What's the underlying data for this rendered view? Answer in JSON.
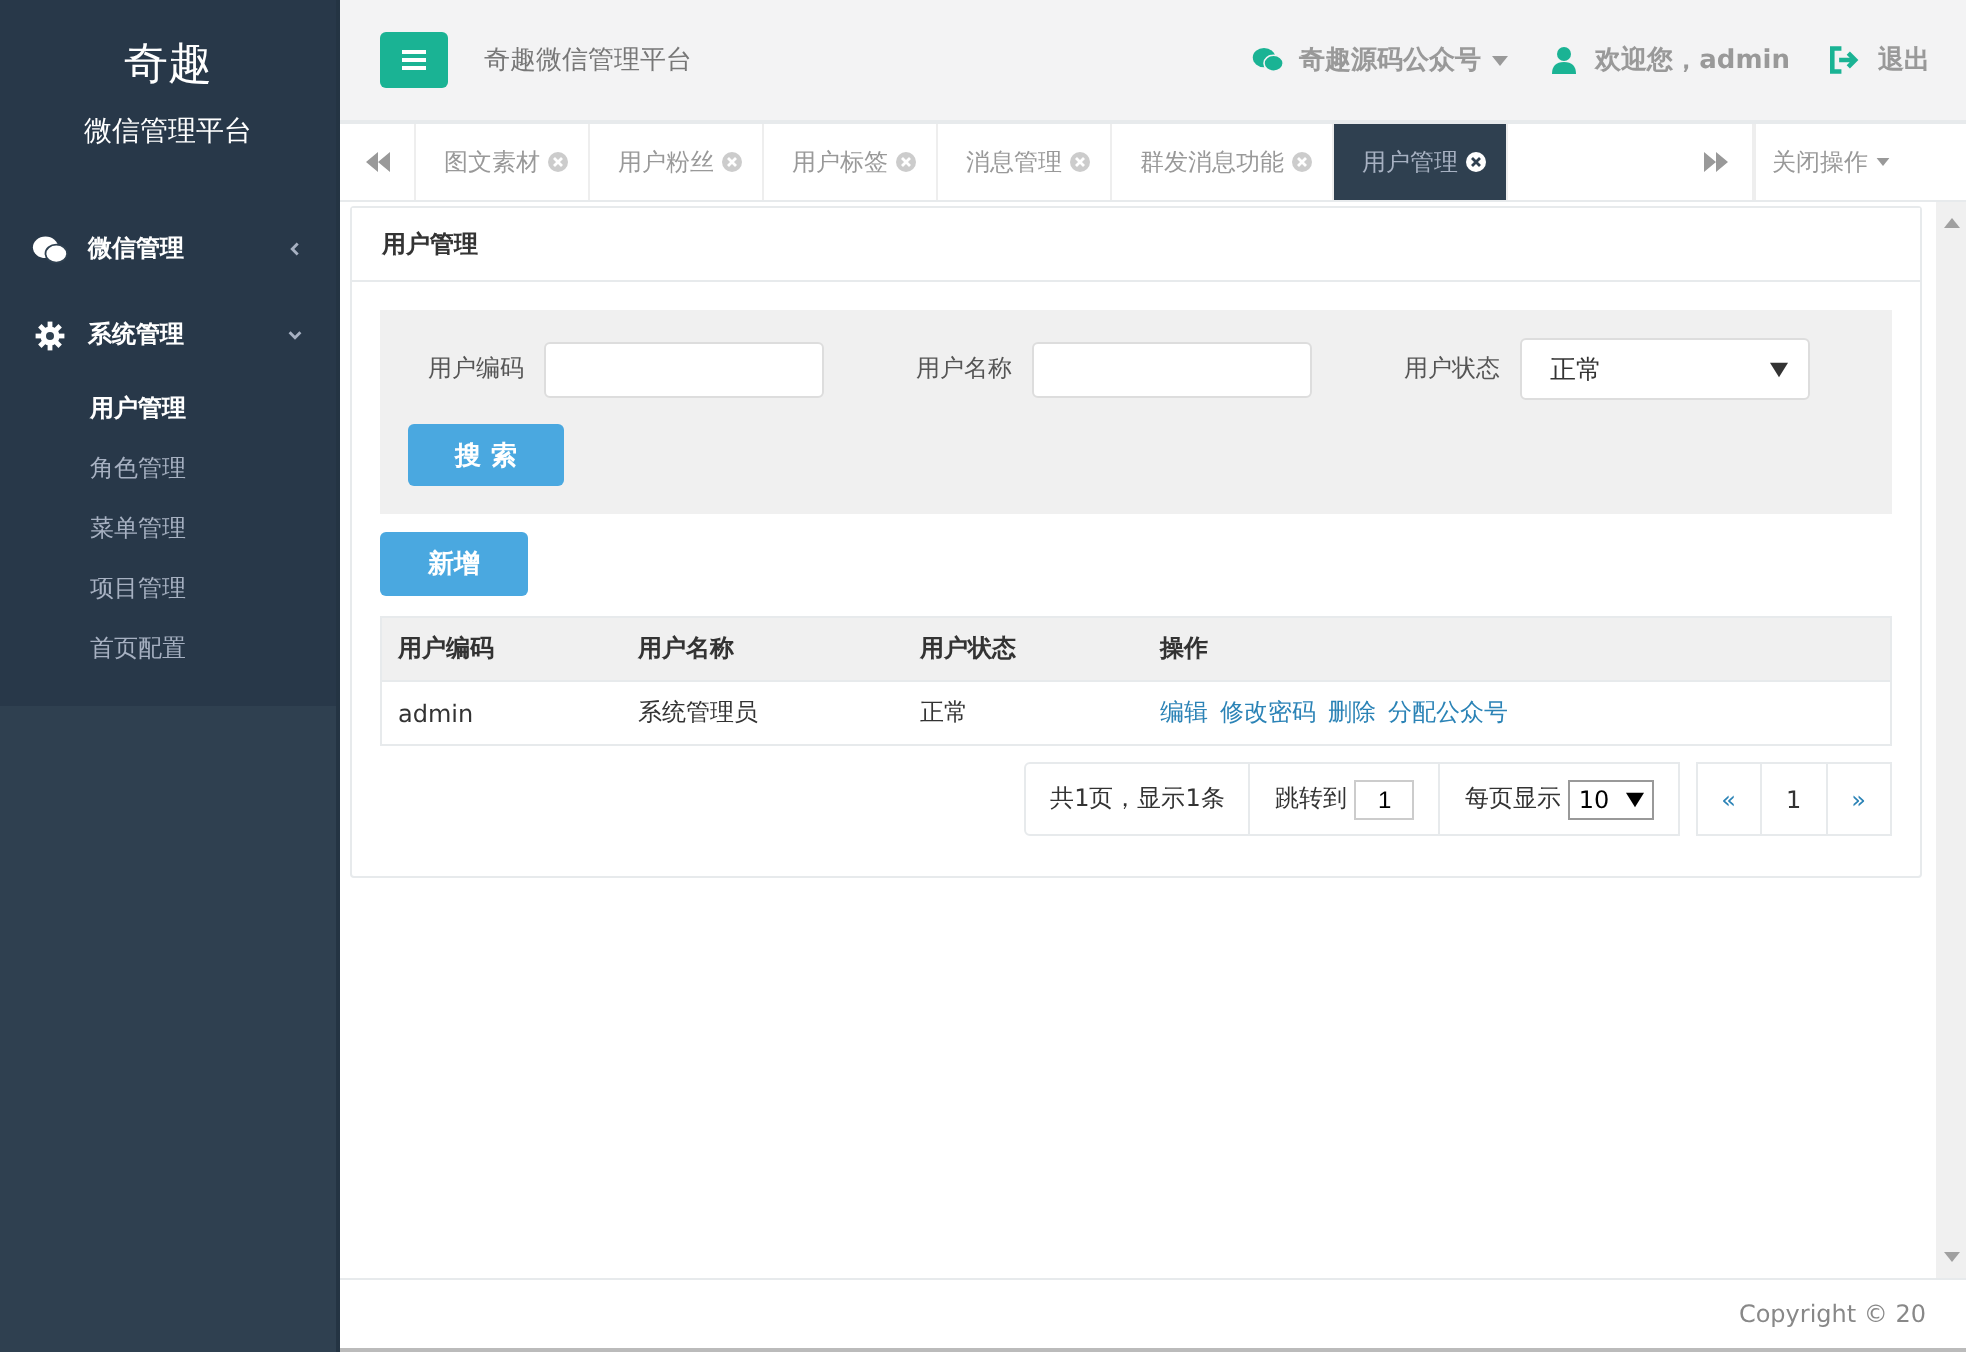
{
  "sidebar": {
    "logo": "奇趣",
    "subtitle": "微信管理平台",
    "groups": [
      {
        "label": "微信管理",
        "expanded": false
      },
      {
        "label": "系统管理",
        "expanded": true,
        "children": [
          {
            "label": "用户管理",
            "selected": true
          },
          {
            "label": "角色管理",
            "selected": false
          },
          {
            "label": "菜单管理",
            "selected": false
          },
          {
            "label": "项目管理",
            "selected": false
          },
          {
            "label": "首页配置",
            "selected": false
          }
        ]
      }
    ]
  },
  "header": {
    "title": "奇趣微信管理平台",
    "account": "奇趣源码公众号",
    "welcome": "欢迎您，admin",
    "logout": "退出"
  },
  "tabs": [
    {
      "label": "图文素材",
      "selected": false
    },
    {
      "label": "用户粉丝",
      "selected": false
    },
    {
      "label": "用户标签",
      "selected": false
    },
    {
      "label": "消息管理",
      "selected": false
    },
    {
      "label": "群发消息功能",
      "selected": false
    },
    {
      "label": "用户管理",
      "selected": true
    }
  ],
  "close_menu": "关闭操作",
  "panel": {
    "title": "用户管理",
    "filters": [
      {
        "label": "用户编码",
        "kind": "text"
      },
      {
        "label": "用户名称",
        "kind": "text"
      },
      {
        "label": "用户状态",
        "kind": "select",
        "value": "正常"
      }
    ],
    "search_button": "搜 索",
    "add_button": "新增",
    "table": {
      "columns": [
        "用户编码",
        "用户名称",
        "用户状态",
        "操作"
      ],
      "rows": [
        {
          "cells": [
            "admin",
            "系统管理员",
            "正常"
          ],
          "actions": [
            "编辑",
            "修改密码",
            "删除",
            "分配公众号"
          ]
        }
      ]
    },
    "pagination": {
      "summary": "共1页，显示1条",
      "jump_label": "跳转到",
      "jump_value": "1",
      "per_page_label": "每页显示",
      "per_page": "10",
      "prev": "«",
      "pages": [
        {
          "label": "1",
          "selected": true
        }
      ],
      "next": "»"
    }
  },
  "footer": "Copyright © 20"
}
